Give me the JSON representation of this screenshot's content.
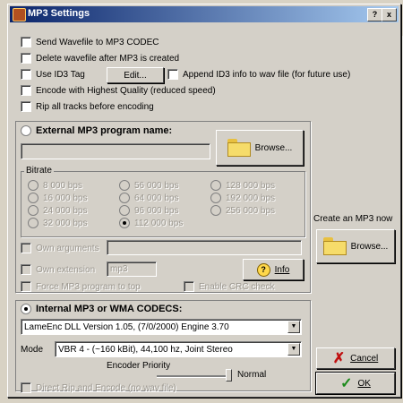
{
  "window": {
    "title": "MP3 Settings",
    "help_label": "?",
    "close_label": "x"
  },
  "options": [
    {
      "label": "Send Wavefile to MP3 CODEC",
      "checked": false
    },
    {
      "label": "Delete wavefile after MP3 is created",
      "checked": false
    },
    {
      "label": "Use ID3 Tag",
      "checked": false
    },
    {
      "label": "Encode with Highest Quality (reduced speed)",
      "checked": false
    },
    {
      "label": "Rip all tracks before encoding",
      "checked": false
    }
  ],
  "id3": {
    "edit_label": "Edit...",
    "append_label": "Append ID3 info to wav file (for future use)"
  },
  "external": {
    "radio_label": "External MP3 program name:",
    "selected": false,
    "path_value": "",
    "browse_label": "Browse...",
    "bitrate_label": "Bitrate",
    "bitrates": [
      "8 000 bps",
      "56 000 bps",
      "128 000 bps",
      "16 000 bps",
      "64 000 bps",
      "192 000 bps",
      "24 000 bps",
      "96 000 bps",
      "256 000 bps",
      "32 000 bps",
      "112 000 bps"
    ],
    "selected_bitrate": "112 000 bps",
    "own_arguments_label": "Own arguments",
    "own_extension_label": "Own extension",
    "own_extension_value": "mp3",
    "info_label": "Info",
    "force_label": "Force MP3 program to top",
    "crc_label": "Enable CRC check"
  },
  "side": {
    "create_now_label": "Create an MP3 now",
    "browse_label": "Browse..."
  },
  "internal": {
    "radio_label": "Internal MP3 or WMA CODECS:",
    "selected": true,
    "codec_value": "LameEnc DLL Version 1.05, (7/0/2000) Engine 3.70",
    "mode_label": "Mode",
    "mode_value": "VBR 4 - (~160 kBit), 44,100 hz, Joint Stereo",
    "priority_label": "Encoder Priority",
    "priority_value_label": "Normal",
    "direct_rip_label": "Direct Rip and Encode (no wav file)"
  },
  "buttons": {
    "cancel_label": "Cancel",
    "ok_label": "OK"
  }
}
